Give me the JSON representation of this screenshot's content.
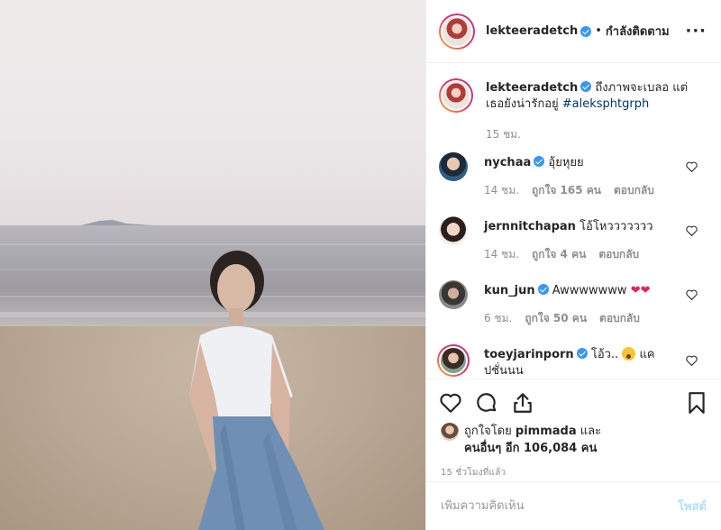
{
  "post_author": {
    "username": "lekteeradetch",
    "dot": "•",
    "follow_status": "กำลังติดตาม",
    "more_icon": "more-options-icon"
  },
  "caption": {
    "username": "lekteeradetch",
    "text": "ถึงภาพจะเบลอ แต่เธอยังน่ารักอยู่",
    "hashtag": "#aleksphtgrph",
    "time": "15 ชม."
  },
  "comments": [
    {
      "username": "nycha​a",
      "text": "อุ้ยหุยย",
      "time": "14 ชม.",
      "likes": "ถูกใจ 165 คน",
      "reply": "ตอบกลับ",
      "verified": true
    },
    {
      "username": "jernnitchapan",
      "text": "โอ้โหววววววว",
      "time": "14 ชม.",
      "likes": "ถูกใจ 4 คน",
      "reply": "ตอบกลับ",
      "verified": false
    },
    {
      "username": "kun_jun",
      "text": "Awwwwwww",
      "time": "6 ชม.",
      "likes": "ถูกใจ 50 คน",
      "reply": "ตอบกลับ",
      "verified": true
    },
    {
      "username": "toeyjarinporn",
      "text": "โอ้ว..",
      "text2": "แค",
      "text3": "ปชั่นนน",
      "verified": true
    }
  ],
  "likes": {
    "prefix": "ถูกใจโดย",
    "user": "pimmada",
    "and": "และ",
    "others_prefix": "คนอื่นๆ อีก",
    "count": "106,084",
    "suffix": "คน"
  },
  "time_ago": "15 ชั่วโมงที่แล้ว",
  "add_comment": {
    "placeholder": "เพิ่มความคิดเห็น",
    "post_label": "โพสต์"
  },
  "colors": {
    "verified": "#3897f0",
    "hashtag": "#003569",
    "muted": "#8e8e8e",
    "post_disabled": "#b2dffc",
    "heart_emoji": "#e0245e"
  }
}
